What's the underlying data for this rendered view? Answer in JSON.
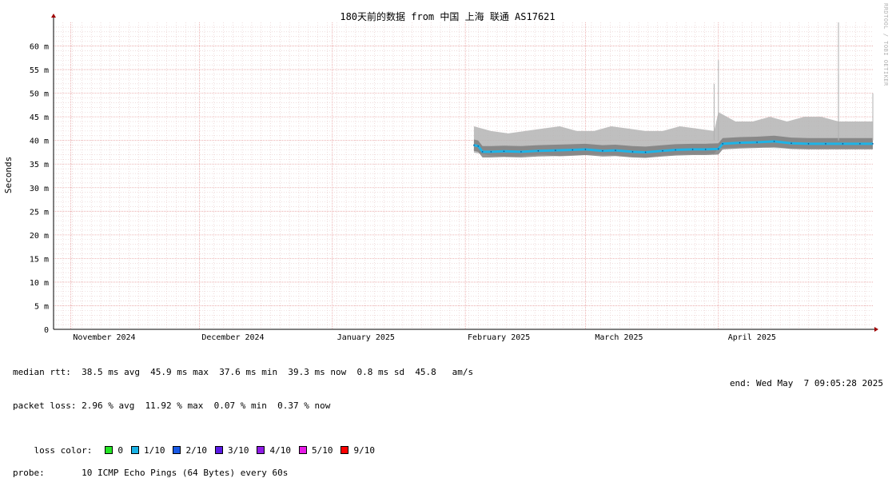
{
  "chart_data": {
    "type": "line",
    "title": "180天前的数据 from 中国 上海 联通 AS17621",
    "ylabel": "Seconds",
    "y_ticks": [
      {
        "value": 0,
        "label": "0"
      },
      {
        "value": 5,
        "label": "5 m"
      },
      {
        "value": 10,
        "label": "10 m"
      },
      {
        "value": 15,
        "label": "15 m"
      },
      {
        "value": 20,
        "label": "20 m"
      },
      {
        "value": 25,
        "label": "25 m"
      },
      {
        "value": 30,
        "label": "30 m"
      },
      {
        "value": 35,
        "label": "35 m"
      },
      {
        "value": 40,
        "label": "40 m"
      },
      {
        "value": 45,
        "label": "45 m"
      },
      {
        "value": 50,
        "label": "50 m"
      },
      {
        "value": 55,
        "label": "55 m"
      },
      {
        "value": 60,
        "label": "60 m"
      }
    ],
    "ylim": [
      0,
      65
    ],
    "x_range": [
      "2024-10-28",
      "2025-05-07"
    ],
    "x_ticks": [
      {
        "date": "2024-11-01",
        "label": "November 2024"
      },
      {
        "date": "2024-12-01",
        "label": "December 2024"
      },
      {
        "date": "2025-01-01",
        "label": "January 2025"
      },
      {
        "date": "2025-02-01",
        "label": "February 2025"
      },
      {
        "date": "2025-03-01",
        "label": "March 2025"
      },
      {
        "date": "2025-04-01",
        "label": "April 2025"
      }
    ],
    "grid": true,
    "series": [
      {
        "name": "median rtt",
        "color": "#1fb3e6",
        "x": [
          "2025-02-03",
          "2025-02-04",
          "2025-02-05",
          "2025-02-07",
          "2025-02-10",
          "2025-02-14",
          "2025-02-18",
          "2025-02-22",
          "2025-02-26",
          "2025-03-01",
          "2025-03-05",
          "2025-03-08",
          "2025-03-12",
          "2025-03-15",
          "2025-03-19",
          "2025-03-22",
          "2025-03-26",
          "2025-03-29",
          "2025-04-01",
          "2025-04-02",
          "2025-04-06",
          "2025-04-10",
          "2025-04-14",
          "2025-04-18",
          "2025-04-22",
          "2025-04-26",
          "2025-04-30",
          "2025-05-04",
          "2025-05-07"
        ],
        "y": [
          39.0,
          38.8,
          37.6,
          37.6,
          37.7,
          37.6,
          37.8,
          37.9,
          38.0,
          38.1,
          37.8,
          37.9,
          37.6,
          37.5,
          37.8,
          38.0,
          38.1,
          38.1,
          38.2,
          39.3,
          39.5,
          39.6,
          39.8,
          39.4,
          39.3,
          39.3,
          39.3,
          39.3,
          39.3
        ]
      },
      {
        "name": "rtt max envelope",
        "color": "#b4b4b4",
        "x": [
          "2025-02-03",
          "2025-02-07",
          "2025-02-11",
          "2025-02-15",
          "2025-02-19",
          "2025-02-23",
          "2025-02-27",
          "2025-03-03",
          "2025-03-07",
          "2025-03-11",
          "2025-03-15",
          "2025-03-19",
          "2025-03-23",
          "2025-03-27",
          "2025-03-31",
          "2025-04-01",
          "2025-04-05",
          "2025-04-09",
          "2025-04-13",
          "2025-04-17",
          "2025-04-21",
          "2025-04-25",
          "2025-04-29",
          "2025-05-03",
          "2025-05-07"
        ],
        "y": [
          43,
          42,
          41.5,
          42,
          42.5,
          43,
          42,
          42,
          43,
          42.5,
          42,
          42,
          43,
          42.5,
          42,
          46,
          44,
          44,
          45,
          44,
          45,
          45,
          44,
          44,
          44
        ]
      }
    ],
    "spikes": [
      {
        "x": "2025-04-01",
        "y": 57
      },
      {
        "x": "2025-03-31",
        "y": 52
      },
      {
        "x": "2025-04-29",
        "y": 65
      },
      {
        "x": "2025-04-29",
        "y": 54
      },
      {
        "x": "2025-05-07",
        "y": 50
      }
    ],
    "min_y": [
      37.4,
      36.8,
      36.5,
      36.8,
      37.0,
      36.6,
      36.8,
      37.0,
      36.9,
      36.6,
      36.4,
      36.8,
      37.0,
      37.1,
      37.2,
      38.4,
      38.5,
      38.6,
      38.4,
      38.3,
      38.3,
      38.3,
      38.3,
      38.3,
      38.3
    ]
  },
  "stats": {
    "median_rtt": "median rtt:  38.5 ms avg  45.9 ms max  37.6 ms min  39.3 ms now  0.8 ms sd  45.8   am/s",
    "packet_loss": "packet loss: 2.96 % avg  11.92 % max  0.07 % min  0.37 % now",
    "loss_color_label": "loss color:",
    "loss_colors": [
      {
        "label": "0",
        "color": "#26e626"
      },
      {
        "label": "1/10",
        "color": "#1ab3e6"
      },
      {
        "label": "2/10",
        "color": "#1a5ae6"
      },
      {
        "label": "3/10",
        "color": "#5a1ae6"
      },
      {
        "label": "4/10",
        "color": "#8f1ae6"
      },
      {
        "label": "5/10",
        "color": "#e61ae6"
      },
      {
        "label": "9/10",
        "color": "#ff0000"
      }
    ],
    "probe": "probe:       10 ICMP Echo Pings (64 Bytes) every 60s",
    "end": "end: Wed May  7 09:05:28 2025"
  },
  "watermark": "RRDTOOL / TOBI OETIKER"
}
